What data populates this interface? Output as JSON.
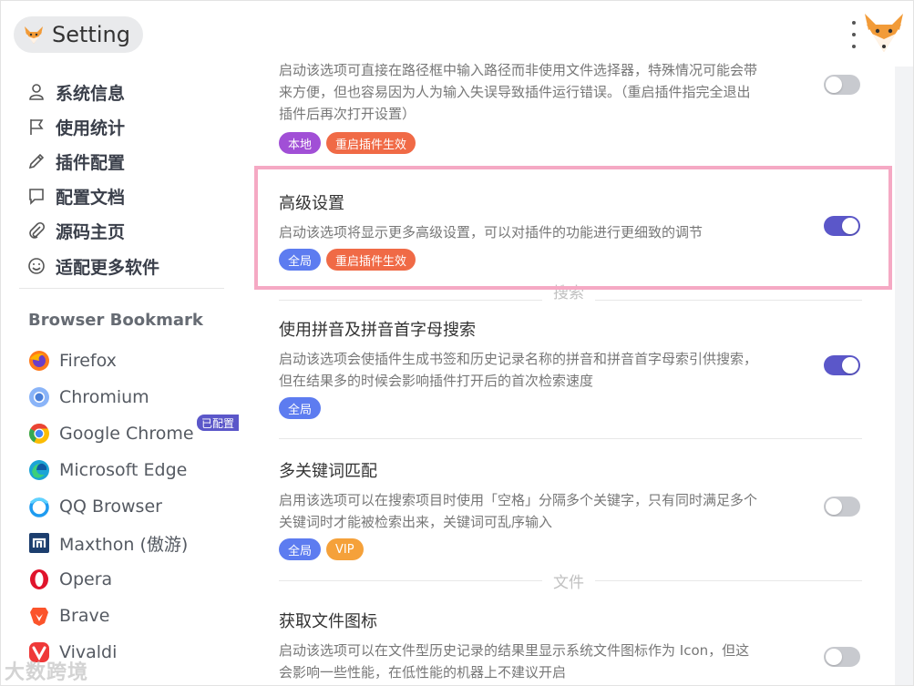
{
  "app": {
    "title": "Setting"
  },
  "sidebar": {
    "menu": [
      {
        "label": "系统信息",
        "icon": "user-icon"
      },
      {
        "label": "使用统计",
        "icon": "flag-icon"
      },
      {
        "label": "插件配置",
        "icon": "pencil-icon"
      },
      {
        "label": "配置文档",
        "icon": "chat-icon"
      },
      {
        "label": "源码主页",
        "icon": "paperclip-icon"
      },
      {
        "label": "适配更多软件",
        "icon": "smile-icon"
      }
    ],
    "section_title": "Browser Bookmark",
    "browsers": [
      {
        "label": "Firefox",
        "icon": "firefox-icon"
      },
      {
        "label": "Chromium",
        "icon": "chromium-icon"
      },
      {
        "label": "Google Chrome",
        "icon": "chrome-icon",
        "badge": "已配置"
      },
      {
        "label": "Microsoft Edge",
        "icon": "edge-icon"
      },
      {
        "label": "QQ Browser",
        "icon": "qq-browser-icon"
      },
      {
        "label": "Maxthon (傲游)",
        "icon": "maxthon-icon"
      },
      {
        "label": "Opera",
        "icon": "opera-icon"
      },
      {
        "label": "Brave",
        "icon": "brave-icon"
      },
      {
        "label": "Vivaldi",
        "icon": "vivaldi-icon"
      }
    ]
  },
  "settings": {
    "top_partial": {
      "desc": "启动该选项可直接在路径框中输入路径而非使用文件选择器，特殊情况可能会带来方便，但也容易因为人为输入失误导致插件运行错误。（重启插件指完全退出插件后再次打开设置）",
      "tags": [
        "本地",
        "重启插件生效"
      ],
      "enabled": false
    },
    "advanced": {
      "title": "高级设置",
      "desc": "启动该选项将显示更多高级设置，可以对插件的功能进行更细致的调节",
      "tags": [
        "全局",
        "重启插件生效"
      ],
      "enabled": true
    },
    "section_search": "搜索",
    "pinyin": {
      "title": "使用拼音及拼音首字母搜索",
      "desc": "启动该选项会使插件生成书签和历史记录名称的拼音和拼音首字母索引供搜索，但在结果多的时候会影响插件打开后的首次检索速度",
      "tags": [
        "全局"
      ],
      "enabled": true
    },
    "multi_keyword": {
      "title": "多关键词匹配",
      "desc": "启用该选项可以在搜索项目时使用「空格」分隔多个关键字，只有同时满足多个关键词时才能被检索出来，关键词可乱序输入",
      "tags": [
        "全局",
        "VIP"
      ],
      "enabled": false
    },
    "section_file": "文件",
    "file_icon": {
      "title": "获取文件图标",
      "desc": "启动该选项可以在文件型历史记录的结果里显示系统文件图标作为 Icon，但这会影响一些性能，在低性能的机器上不建议开启",
      "enabled": false
    }
  },
  "colors": {
    "accent": "#5b57c9",
    "tag_local": "#a14fd6",
    "tag_restart": "#f06a46",
    "tag_global": "#5d7cf0",
    "tag_vip": "#f5a13a",
    "highlight_border": "#f5a9c4"
  },
  "watermark": "大数跨境"
}
